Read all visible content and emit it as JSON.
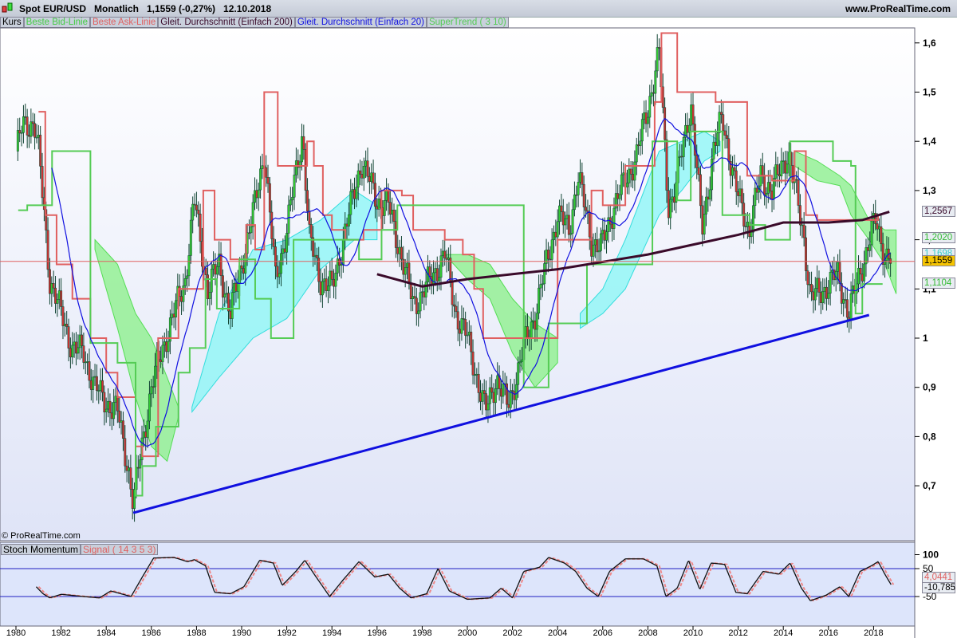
{
  "header": {
    "title": "Spot EUR/USD   Monatlich   1,1559 (-0,27%)   12.10.2018",
    "site": "www.ProRealTime.com",
    "copyright": "© ProRealTime.com"
  },
  "legend": [
    {
      "label": "Kurs",
      "color": "#000000"
    },
    {
      "label": "Beste Bid-Linie",
      "color": "#44cc44"
    },
    {
      "label": "Beste Ask-Linie",
      "color": "#e06060"
    },
    {
      "label": "Gleit. Durchschnitt (Einfach 200)",
      "color": "#3a0a2a"
    },
    {
      "label": "Gleit. Durchschnitt (Einfach 20)",
      "color": "#1010e0"
    },
    {
      "label": "SuperTrend ( 3 10)",
      "color": "#55cc55"
    }
  ],
  "stoch_legend": [
    {
      "label": "Stoch Momentum",
      "color": "#000000"
    },
    {
      "label": "Signal ( 14 3 5 3)",
      "color": "#e06060"
    }
  ],
  "price_labels": [
    {
      "text": "1,2567",
      "color": "#3a0a2a",
      "v": 1.2567
    },
    {
      "text": "1,2020",
      "color": "#33bb33",
      "v": 1.202
    },
    {
      "text": "1,1698",
      "color": "#33cccc",
      "v": 1.1698
    },
    {
      "text": "1,1559",
      "color": "#000000",
      "v": 1.1559,
      "bg": "#f5c400"
    },
    {
      "text": "1,1104",
      "color": "#33bb33",
      "v": 1.1104
    }
  ],
  "stoch_labels": [
    {
      "text": "4,0441",
      "color": "#e06060",
      "v": 4.0441
    },
    {
      "text": "-10,785",
      "color": "#000000",
      "v": -10.785
    }
  ],
  "chart_data": {
    "type": "candlestick",
    "title": "Spot EUR/USD Monatlich",
    "ylim": [
      0.62,
      1.64
    ],
    "yticks": [
      0.7,
      0.8,
      0.9,
      1.0,
      1.1,
      1.2,
      1.3,
      1.4,
      1.5,
      1.6
    ],
    "ytick_labels": [
      "0,7",
      "0,8",
      "0,9",
      "1",
      "1,1",
      "1,2",
      "1,3",
      "1,4",
      "1,5",
      "1,6"
    ],
    "xticks": [
      1980,
      1982,
      1984,
      1986,
      1988,
      1990,
      1992,
      1994,
      1996,
      1998,
      2000,
      2002,
      2004,
      2006,
      2008,
      2010,
      2012,
      2014,
      2016,
      2018
    ],
    "close_keypoints": [
      [
        1980,
        1.38
      ],
      [
        1980.3,
        1.43
      ],
      [
        1980.8,
        1.44
      ],
      [
        1981,
        1.38
      ],
      [
        1981.5,
        1.12
      ],
      [
        1982,
        1.05
      ],
      [
        1982.5,
        0.98
      ],
      [
        1983,
        0.97
      ],
      [
        1983.5,
        0.9
      ],
      [
        1984,
        0.87
      ],
      [
        1984.5,
        0.85
      ],
      [
        1985,
        0.73
      ],
      [
        1985.2,
        0.66
      ],
      [
        1985.5,
        0.76
      ],
      [
        1986,
        0.9
      ],
      [
        1986.5,
        0.98
      ],
      [
        1987,
        1.05
      ],
      [
        1987.5,
        1.12
      ],
      [
        1987.9,
        1.28
      ],
      [
        1988.5,
        1.1
      ],
      [
        1989,
        1.15
      ],
      [
        1989.5,
        1.05
      ],
      [
        1990,
        1.15
      ],
      [
        1990.5,
        1.25
      ],
      [
        1991,
        1.38
      ],
      [
        1991.5,
        1.12
      ],
      [
        1992,
        1.22
      ],
      [
        1992.7,
        1.42
      ],
      [
        1993,
        1.2
      ],
      [
        1993.5,
        1.12
      ],
      [
        1994,
        1.1
      ],
      [
        1994.5,
        1.2
      ],
      [
        1995,
        1.3
      ],
      [
        1995.3,
        1.36
      ],
      [
        1996,
        1.28
      ],
      [
        1996.5,
        1.27
      ],
      [
        1997,
        1.18
      ],
      [
        1997.6,
        1.07
      ],
      [
        1998,
        1.09
      ],
      [
        1998.5,
        1.13
      ],
      [
        1999,
        1.17
      ],
      [
        1999.5,
        1.05
      ],
      [
        2000,
        1.0
      ],
      [
        2000.8,
        0.85
      ],
      [
        2001.3,
        0.92
      ],
      [
        2001.8,
        0.86
      ],
      [
        2002.5,
        0.98
      ],
      [
        2003,
        1.05
      ],
      [
        2003.5,
        1.15
      ],
      [
        2004,
        1.25
      ],
      [
        2004.5,
        1.22
      ],
      [
        2004.9,
        1.33
      ],
      [
        2005.5,
        1.2
      ],
      [
        2005.9,
        1.18
      ],
      [
        2006.5,
        1.27
      ],
      [
        2007,
        1.32
      ],
      [
        2007.5,
        1.37
      ],
      [
        2008,
        1.47
      ],
      [
        2008.5,
        1.58
      ],
      [
        2008.9,
        1.27
      ],
      [
        2009.2,
        1.3
      ],
      [
        2009.9,
        1.48
      ],
      [
        2010.4,
        1.22
      ],
      [
        2010.9,
        1.38
      ],
      [
        2011.3,
        1.45
      ],
      [
        2011.9,
        1.3
      ],
      [
        2012.5,
        1.22
      ],
      [
        2013,
        1.33
      ],
      [
        2013.5,
        1.3
      ],
      [
        2014.2,
        1.38
      ],
      [
        2014.9,
        1.21
      ],
      [
        2015.2,
        1.08
      ],
      [
        2015.8,
        1.1
      ],
      [
        2016.4,
        1.13
      ],
      [
        2016.9,
        1.05
      ],
      [
        2017.5,
        1.15
      ],
      [
        2018.1,
        1.24
      ],
      [
        2018.5,
        1.17
      ],
      [
        2018.8,
        1.1559
      ]
    ],
    "sma200": [
      [
        1996,
        1.13
      ],
      [
        1998,
        1.105
      ],
      [
        2000,
        1.12
      ],
      [
        2002,
        1.13
      ],
      [
        2004,
        1.14
      ],
      [
        2006,
        1.155
      ],
      [
        2008,
        1.17
      ],
      [
        2010,
        1.19
      ],
      [
        2012,
        1.21
      ],
      [
        2014,
        1.235
      ],
      [
        2016,
        1.235
      ],
      [
        2017.5,
        1.24
      ],
      [
        2018.7,
        1.2567
      ]
    ],
    "ask_line": [
      [
        1981,
        1.46
      ],
      [
        1981.3,
        1.25
      ],
      [
        1981.8,
        1.15
      ],
      [
        1982.5,
        1.08
      ],
      [
        1983.3,
        1.0
      ],
      [
        1984,
        0.93
      ],
      [
        1984.5,
        0.88
      ],
      [
        1985.3,
        0.78
      ],
      [
        1985.6,
        0.76
      ],
      [
        1986.3,
        1.0
      ],
      [
        1987.2,
        1.1
      ],
      [
        1988.3,
        1.3
      ],
      [
        1988.8,
        1.2
      ],
      [
        1989.5,
        1.16
      ],
      [
        1990.2,
        1.23
      ],
      [
        1990.6,
        1.18
      ],
      [
        1991,
        1.5
      ],
      [
        1991.6,
        1.35
      ],
      [
        1992.5,
        1.35
      ],
      [
        1992.9,
        1.4
      ],
      [
        1993.2,
        1.35
      ],
      [
        1993.6,
        1.25
      ],
      [
        1994,
        1.22
      ],
      [
        1994.6,
        1.2
      ],
      [
        1995.4,
        1.22
      ],
      [
        1996.2,
        1.3
      ],
      [
        1997.1,
        1.29
      ],
      [
        1997.6,
        1.22
      ],
      [
        1999,
        1.2
      ],
      [
        1999.8,
        1.17
      ],
      [
        2000.3,
        1.1
      ],
      [
        2000.7,
        1.0
      ],
      [
        2002.3,
        1.0
      ],
      [
        2004,
        1.2
      ],
      [
        2005.5,
        1.3
      ],
      [
        2006,
        1.27
      ],
      [
        2007,
        1.35
      ],
      [
        2008.3,
        1.48
      ],
      [
        2008.6,
        1.62
      ],
      [
        2009.3,
        1.5
      ],
      [
        2010.6,
        1.5
      ],
      [
        2011,
        1.48
      ],
      [
        2012.4,
        1.33
      ],
      [
        2013.5,
        1.32
      ],
      [
        2014.5,
        1.38
      ],
      [
        2015,
        1.25
      ],
      [
        2015.5,
        1.24
      ],
      [
        2017.5,
        1.24
      ],
      [
        2018.2,
        1.25
      ]
    ],
    "supertrend": [
      [
        1980.1,
        1.26
      ],
      [
        1980.5,
        1.27
      ],
      [
        1981.6,
        1.38
      ],
      [
        1983.2,
        1.38
      ],
      [
        1983.3,
        0.99
      ],
      [
        1984.5,
        0.95
      ],
      [
        1985.3,
        0.68
      ],
      [
        1985.6,
        0.74
      ],
      [
        1986.2,
        0.82
      ],
      [
        1987.2,
        0.93
      ],
      [
        1987.7,
        0.98
      ],
      [
        1988.4,
        1.12
      ],
      [
        1988.9,
        1.06
      ],
      [
        1989.9,
        1.16
      ],
      [
        1990.6,
        1.08
      ],
      [
        1991.3,
        1.0
      ],
      [
        1992.3,
        1.2
      ],
      [
        1993.4,
        1.2
      ],
      [
        1994.2,
        1.2
      ],
      [
        1995.2,
        1.16
      ],
      [
        1996.2,
        1.22
      ],
      [
        1996.9,
        1.27
      ],
      [
        1998.3,
        1.27
      ],
      [
        1999.6,
        1.27
      ],
      [
        2002.5,
        0.9
      ],
      [
        2003.6,
        1.03
      ],
      [
        2005.3,
        1.15
      ],
      [
        2008.2,
        1.4
      ],
      [
        2009.3,
        1.28
      ],
      [
        2009.9,
        1.42
      ],
      [
        2010.4,
        1.42
      ],
      [
        2011.3,
        1.25
      ],
      [
        2012.5,
        1.23
      ],
      [
        2013.2,
        1.2
      ],
      [
        2014.3,
        1.4
      ],
      [
        2015,
        1.4
      ],
      [
        2016.2,
        1.36
      ],
      [
        2017,
        1.35
      ],
      [
        2017.2,
        1.05
      ],
      [
        2017.5,
        1.11
      ],
      [
        2018.4,
        1.11
      ]
    ],
    "trendline": [
      [
        1985.2,
        0.645
      ],
      [
        2017.8,
        1.047
      ]
    ],
    "last_price": 1.1559,
    "clouds": [
      {
        "color": "green",
        "pts": [
          [
            1983.5,
            1.2,
            1.18
          ],
          [
            1984.5,
            1.15,
            1.02
          ],
          [
            1985.3,
            1.05,
            0.88
          ],
          [
            1986,
            1.0,
            0.78
          ],
          [
            1986.7,
            0.92,
            0.75
          ],
          [
            1987.2,
            0.86,
            0.84
          ]
        ]
      },
      {
        "color": "cyan",
        "pts": [
          [
            1987.8,
            0.86,
            0.85
          ],
          [
            1989,
            1.05,
            0.92
          ],
          [
            1990.5,
            1.18,
            1.0
          ],
          [
            1992,
            1.2,
            1.04
          ],
          [
            1993.5,
            1.24,
            1.14
          ],
          [
            1995,
            1.3,
            1.2
          ],
          [
            1996,
            1.27,
            1.2
          ]
        ]
      },
      {
        "color": "green",
        "pts": [
          [
            1999,
            1.17,
            1.17
          ],
          [
            2000,
            1.17,
            1.12
          ],
          [
            2001,
            1.15,
            1.08
          ],
          [
            2002,
            1.08,
            0.97
          ],
          [
            2003,
            1.03,
            0.9
          ],
          [
            2004,
            1.0,
            0.95
          ]
        ]
      },
      {
        "color": "cyan",
        "pts": [
          [
            2005,
            1.05,
            1.02
          ],
          [
            2006,
            1.1,
            1.05
          ],
          [
            2007,
            1.2,
            1.1
          ],
          [
            2008.5,
            1.38,
            1.25
          ],
          [
            2009.5,
            1.4,
            1.3
          ],
          [
            2010.5,
            1.42,
            1.36
          ],
          [
            2011.2,
            1.4,
            1.38
          ]
        ]
      },
      {
        "color": "green",
        "pts": [
          [
            2014.5,
            1.38,
            1.35
          ],
          [
            2015.5,
            1.36,
            1.32
          ],
          [
            2016.5,
            1.33,
            1.31
          ],
          [
            2017,
            1.31,
            1.25
          ],
          [
            2017.8,
            1.24,
            1.2
          ],
          [
            2018.5,
            1.22,
            1.15
          ],
          [
            2019,
            1.22,
            1.09
          ]
        ]
      }
    ],
    "stoch": {
      "ylim": [
        -100,
        110
      ],
      "yticks": [
        100,
        50,
        -50
      ],
      "ytick_labels": [
        "100",
        "50",
        "-50"
      ],
      "keypoints": [
        [
          1980.9,
          -15
        ],
        [
          1981.2,
          -40
        ],
        [
          1981.5,
          -55
        ],
        [
          1982,
          -42
        ],
        [
          1983,
          -50
        ],
        [
          1983.7,
          -55
        ],
        [
          1984.2,
          -30
        ],
        [
          1985.1,
          -50
        ],
        [
          1985.6,
          20
        ],
        [
          1986.1,
          88
        ],
        [
          1987,
          90
        ],
        [
          1987.6,
          75
        ],
        [
          1987.9,
          82
        ],
        [
          1988.4,
          60
        ],
        [
          1988.8,
          -35
        ],
        [
          1989.5,
          -40
        ],
        [
          1990.1,
          -15
        ],
        [
          1990.8,
          80
        ],
        [
          1991.4,
          70
        ],
        [
          1991.8,
          -10
        ],
        [
          1992.4,
          40
        ],
        [
          1992.8,
          80
        ],
        [
          1993.3,
          20
        ],
        [
          1993.9,
          -50
        ],
        [
          1994.5,
          10
        ],
        [
          1995.2,
          75
        ],
        [
          1995.9,
          20
        ],
        [
          1996.5,
          30
        ],
        [
          1997,
          -20
        ],
        [
          1997.5,
          -55
        ],
        [
          1998.2,
          -40
        ],
        [
          1998.7,
          50
        ],
        [
          1999.2,
          -30
        ],
        [
          2000,
          -60
        ],
        [
          2001,
          -55
        ],
        [
          2001.5,
          -20
        ],
        [
          2002,
          -55
        ],
        [
          2002.5,
          40
        ],
        [
          2003.2,
          55
        ],
        [
          2003.6,
          90
        ],
        [
          2004.3,
          70
        ],
        [
          2004.8,
          40
        ],
        [
          2005.3,
          -20
        ],
        [
          2005.8,
          -50
        ],
        [
          2006.3,
          40
        ],
        [
          2007,
          85
        ],
        [
          2007.8,
          85
        ],
        [
          2008.4,
          60
        ],
        [
          2008.8,
          -50
        ],
        [
          2009.3,
          -20
        ],
        [
          2009.8,
          80
        ],
        [
          2010.3,
          -25
        ],
        [
          2010.8,
          70
        ],
        [
          2011.4,
          65
        ],
        [
          2011.9,
          -35
        ],
        [
          2012.4,
          -40
        ],
        [
          2013.1,
          40
        ],
        [
          2013.8,
          30
        ],
        [
          2014.3,
          70
        ],
        [
          2014.8,
          -20
        ],
        [
          2015.2,
          -65
        ],
        [
          2015.9,
          -45
        ],
        [
          2016.5,
          -15
        ],
        [
          2016.9,
          -50
        ],
        [
          2017.4,
          40
        ],
        [
          2017.9,
          60
        ],
        [
          2018.2,
          75
        ],
        [
          2018.5,
          30
        ],
        [
          2018.8,
          -10.785
        ]
      ]
    }
  }
}
